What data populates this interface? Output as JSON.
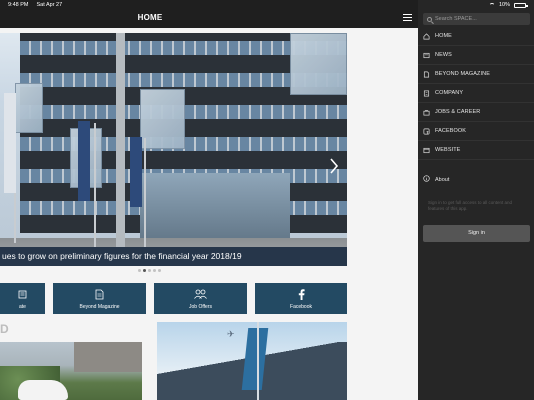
{
  "status": {
    "time": "9:48 PM",
    "date": "Sat Apr 27",
    "battery": "10%",
    "battery_level": 0.1
  },
  "navbar": {
    "title": "HOME"
  },
  "hero": {
    "caption": "ues to grow on preliminary figures for the financial year 2018/19",
    "slide_count": 5,
    "active_slide": 2
  },
  "tiles": [
    {
      "label": "ate",
      "icon": "newspaper-icon"
    },
    {
      "label": "Beyond Magazine",
      "icon": "document-icon"
    },
    {
      "label": "Job Offers",
      "icon": "people-icon"
    },
    {
      "label": "Facebook",
      "icon": "facebook-icon"
    }
  ],
  "section": {
    "letter": "D"
  },
  "drawer": {
    "search_placeholder": "Search SPACE...",
    "items": [
      {
        "label": "HOME",
        "icon": "home-icon"
      },
      {
        "label": "NEWS",
        "icon": "news-icon"
      },
      {
        "label": "BEYOND MAGAZINE",
        "icon": "magazine-icon"
      },
      {
        "label": "COMPANY",
        "icon": "company-icon"
      },
      {
        "label": "JOBS & CAREER",
        "icon": "briefcase-icon"
      },
      {
        "label": "FACEBOOK",
        "icon": "facebook-icon"
      },
      {
        "label": "WEBSITE",
        "icon": "globe-icon"
      }
    ],
    "about_label": "About",
    "signin_hint": "Sign in to get full access to all content and features of this app.",
    "signin_label": "Sign in"
  },
  "colors": {
    "accent": "#234a63",
    "drawer": "#262626",
    "navbar": "#1f1f1f"
  }
}
